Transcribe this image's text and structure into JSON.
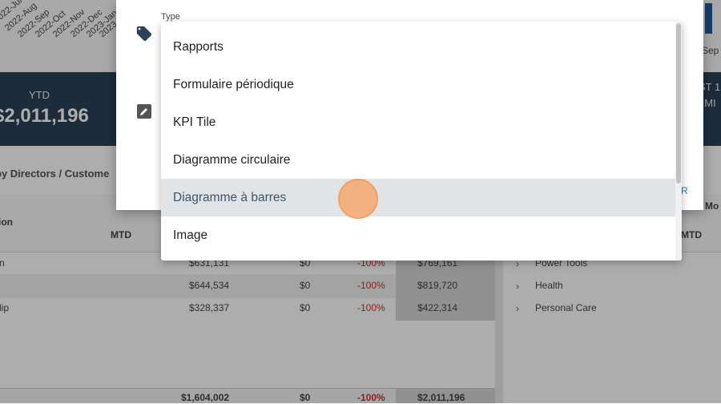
{
  "chart": {
    "date_ticks": [
      "2022-Jul",
      "2022-Aug",
      "2022-Sep",
      "2022-Oct",
      "2022-Nov",
      "2022-Dec",
      "2023-Jan",
      "2023-Feb"
    ],
    "right_tick": "Sep"
  },
  "kpi": {
    "ytd_label": "YTD",
    "ytd_value": "$2,011,196",
    "right_label_1": "ST 1",
    "right_label_2": "2MI"
  },
  "section": {
    "title": "by Directors / Custome"
  },
  "table": {
    "col_first": "ion",
    "col_mtd": "MTD",
    "col_mtd_right": "MTD",
    "col_mo_right": "Mo",
    "rows": [
      {
        "name": "n",
        "v1": "$631,131",
        "v2": "$0",
        "pct": "-100%",
        "v3": "$769,161"
      },
      {
        "name": "",
        "v1": "$644,534",
        "v2": "$0",
        "pct": "-100%",
        "v3": "$819,720"
      },
      {
        "name": "lip",
        "v1": "$328,337",
        "v2": "$0",
        "pct": "-100%",
        "v3": "$422,314"
      }
    ],
    "right_rows": [
      "Power Tools",
      "Health",
      "Personal Care"
    ],
    "totals": {
      "v1": "$1,604,002",
      "v2": "$0",
      "pct": "-100%",
      "v3": "$2,011,196"
    }
  },
  "dialog": {
    "type_label": "Type",
    "action_fragment": "R",
    "icons": {
      "type": "tag-icon",
      "edit": "edit-icon"
    }
  },
  "dropdown": {
    "items": [
      "Rapports",
      "Formulaire périodique",
      "KPI Tile",
      "Diagramme circulaire",
      "Diagramme à barres",
      "Image"
    ],
    "highlighted_index": 4
  },
  "colors": {
    "kpi_band": "#2c4257",
    "highlight": "#e1e4e7",
    "negative": "#d32f2f",
    "accent": "#1976d2",
    "cursor": "#f6a86e"
  }
}
